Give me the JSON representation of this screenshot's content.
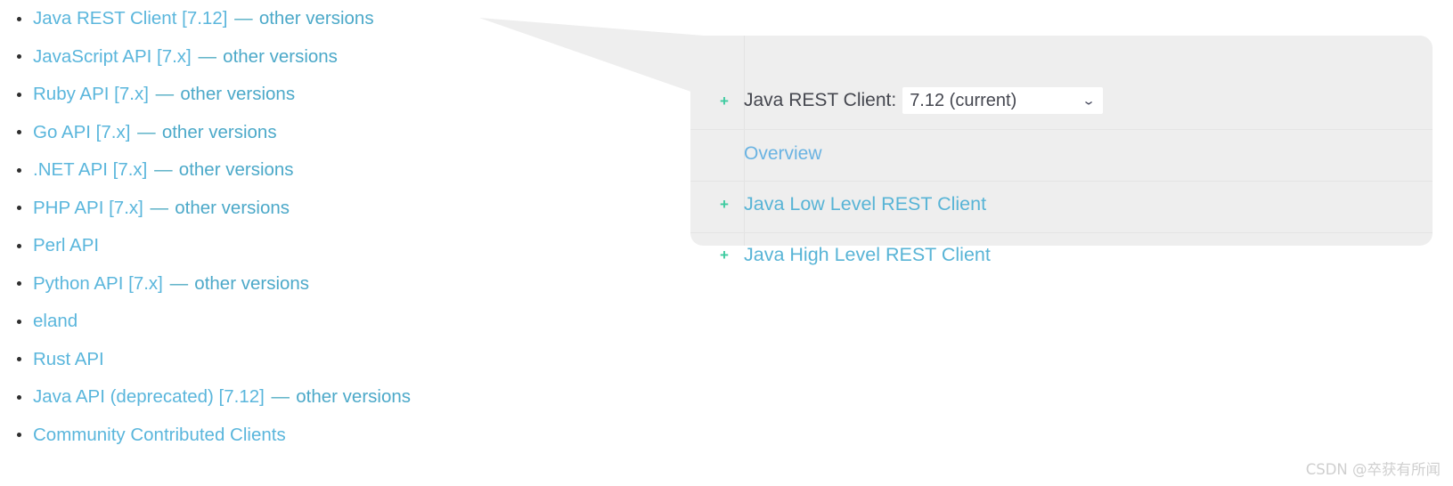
{
  "clients": {
    "items": [
      {
        "name": "Java REST Client",
        "version": "[7.12]",
        "dash": "—",
        "other": "other versions"
      },
      {
        "name": "JavaScript API",
        "version": "[7.x]",
        "dash": "—",
        "other": "other versions"
      },
      {
        "name": "Ruby API",
        "version": "[7.x]",
        "dash": "—",
        "other": "other versions"
      },
      {
        "name": "Go API",
        "version": "[7.x]",
        "dash": "—",
        "other": "other versions"
      },
      {
        "name": ".NET API",
        "version": "[7.x]",
        "dash": "—",
        "other": "other versions"
      },
      {
        "name": "PHP API",
        "version": "[7.x]",
        "dash": "—",
        "other": "other versions"
      },
      {
        "name": "Perl API",
        "version": "",
        "dash": "",
        "other": ""
      },
      {
        "name": "Python API",
        "version": "[7.x]",
        "dash": "—",
        "other": "other versions"
      },
      {
        "name": "eland",
        "version": "",
        "dash": "",
        "other": ""
      },
      {
        "name": "Rust API",
        "version": "",
        "dash": "",
        "other": ""
      },
      {
        "name": "Java API (deprecated)",
        "version": "[7.12]",
        "dash": "—",
        "other": "other versions"
      },
      {
        "name": "Community Contributed Clients",
        "version": "",
        "dash": "",
        "other": ""
      }
    ]
  },
  "callout": {
    "header": {
      "expander": "+",
      "label": "Java REST Client:",
      "selected_version": "7.12 (current)",
      "chevron": "⌄"
    },
    "rows": [
      {
        "expander": "",
        "label": "Overview"
      },
      {
        "expander": "+",
        "label": "Java Low Level REST Client"
      },
      {
        "expander": "+",
        "label": "Java High Level REST Client"
      }
    ]
  },
  "watermark": {
    "text": "CSDN @卒获有所闻"
  },
  "colors": {
    "link_blue": "#5ab6dc",
    "panel_bg": "#eeeeee",
    "expander_green": "#3ecba0",
    "header_text": "#45474f",
    "separator": "#e4e4e4"
  }
}
